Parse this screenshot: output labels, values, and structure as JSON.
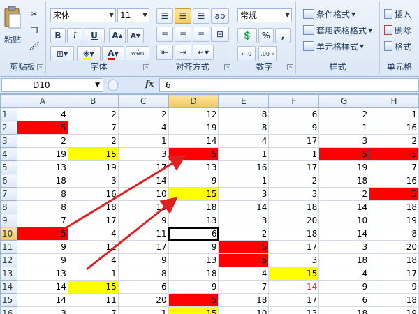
{
  "ribbon": {
    "clipboard": {
      "paste_label": "粘贴",
      "group_label": "剪贴板"
    },
    "font": {
      "font_name": "宋体",
      "font_size": "11",
      "bold": "B",
      "italic": "I",
      "underline": "U",
      "grow": "A",
      "shrink": "A",
      "phonetic": "wén",
      "group_label": "字体"
    },
    "alignment": {
      "group_label": "对齐方式"
    },
    "number": {
      "format": "常规",
      "percent": "%",
      "comma": ",",
      "group_label": "数字"
    },
    "styles": {
      "conditional": "条件格式",
      "table_format": "套用表格格式",
      "cell_style": "单元格样式",
      "group_label": "样式"
    },
    "cells": {
      "insert": "插入",
      "delete": "删除",
      "format": "格式",
      "group_label": "单元格"
    }
  },
  "formula_bar": {
    "cell_ref": "D10",
    "fx": "fx",
    "value": "6"
  },
  "grid": {
    "columns": [
      "A",
      "B",
      "C",
      "D",
      "E",
      "F",
      "G",
      "H"
    ],
    "selected_column": "D",
    "selected_row": "10",
    "rows": [
      {
        "num": "1",
        "cells": [
          "4",
          "2",
          "2",
          "12",
          "8",
          "6",
          "2",
          "1"
        ]
      },
      {
        "num": "2",
        "cells": [
          "5",
          "7",
          "4",
          "19",
          "8",
          "9",
          "1",
          "16"
        ]
      },
      {
        "num": "3",
        "cells": [
          "2",
          "2",
          "1",
          "14",
          "4",
          "17",
          "3",
          "2"
        ]
      },
      {
        "num": "4",
        "cells": [
          "19",
          "15",
          "3",
          "5",
          "1",
          "1",
          "5",
          "5"
        ]
      },
      {
        "num": "5",
        "cells": [
          "13",
          "19",
          "17",
          "13",
          "16",
          "17",
          "19",
          "7"
        ]
      },
      {
        "num": "6",
        "cells": [
          "18",
          "3",
          "14",
          "9",
          "1",
          "2",
          "18",
          "16"
        ]
      },
      {
        "num": "7",
        "cells": [
          "8",
          "16",
          "10",
          "15",
          "3",
          "3",
          "2",
          "5"
        ]
      },
      {
        "num": "8",
        "cells": [
          "8",
          "18",
          "13",
          "18",
          "14",
          "18",
          "14",
          "18"
        ]
      },
      {
        "num": "9",
        "cells": [
          "7",
          "17",
          "9",
          "13",
          "3",
          "20",
          "10",
          "19"
        ]
      },
      {
        "num": "10",
        "cells": [
          "5",
          "4",
          "11",
          "6",
          "2",
          "18",
          "14",
          "8"
        ]
      },
      {
        "num": "11",
        "cells": [
          "9",
          "12",
          "17",
          "9",
          "5",
          "17",
          "3",
          "20"
        ]
      },
      {
        "num": "12",
        "cells": [
          "9",
          "4",
          "9",
          "13",
          "5",
          "3",
          "18",
          "18"
        ]
      },
      {
        "num": "13",
        "cells": [
          "13",
          "1",
          "8",
          "18",
          "4",
          "15",
          "4",
          "17"
        ]
      },
      {
        "num": "14",
        "cells": [
          "14",
          "15",
          "6",
          "9",
          "7",
          "14",
          "9",
          "9"
        ]
      },
      {
        "num": "15",
        "cells": [
          "14",
          "11",
          "20",
          "5",
          "18",
          "17",
          "6",
          "18"
        ]
      },
      {
        "num": "16",
        "cells": [
          "3",
          "7",
          "1",
          "15",
          "10",
          "13",
          "18",
          "19"
        ]
      }
    ],
    "highlights": {
      "red": [
        "A2",
        "D4",
        "G4",
        "H4",
        "H7",
        "A10",
        "E11",
        "E12",
        "D15"
      ],
      "yellow": [
        "B4",
        "D7",
        "F13",
        "B14",
        "D16"
      ],
      "red_text": [
        "F14"
      ]
    },
    "annotation_color": "#e01f1f"
  }
}
